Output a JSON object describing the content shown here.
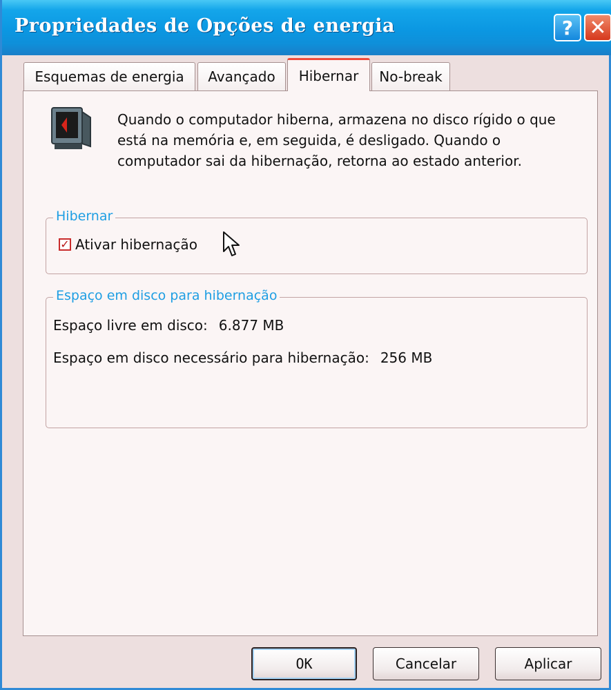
{
  "window": {
    "title": "Propriedades de Opções de energia",
    "help_label": "?",
    "close_label": "✕"
  },
  "tabs": [
    {
      "label": "Esquemas de energia",
      "active": false
    },
    {
      "label": "Avançado",
      "active": false
    },
    {
      "label": "Hibernar",
      "active": true
    },
    {
      "label": "No-break",
      "active": false
    }
  ],
  "panel": {
    "icon": "computer-hibernate-icon",
    "description": "Quando o computador hiberna, armazena no disco rígido o que está na memória e, em seguida, é desligado. Quando o computador sai da hibernação, retorna ao estado anterior.",
    "hibernate_group": {
      "legend": "Hibernar",
      "checkbox_label": "Ativar hibernação",
      "checked": true
    },
    "disk_group": {
      "legend": "Espaço em disco para hibernação",
      "free_label": "Espaço livre em disco:",
      "free_value": "6.877 MB",
      "required_label": "Espaço em disco necessário para hibernação:",
      "required_value": "256 MB"
    }
  },
  "buttons": {
    "ok": "OK",
    "cancel": "Cancelar",
    "apply": "Aplicar"
  },
  "colors": {
    "titlebar": "#0b97e2",
    "group_legend": "#1e9ee3",
    "close_button": "#d6381d",
    "active_tab_accent": "#f04a3a"
  }
}
